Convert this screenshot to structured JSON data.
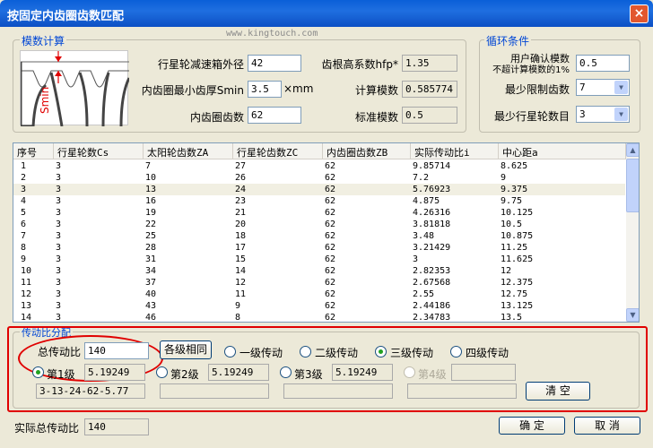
{
  "window": {
    "title": "按固定内齿圈齿数匹配",
    "close_icon": "×",
    "watermark": "www.kingtouch.com"
  },
  "calc_group": {
    "label": "模数计算",
    "diagram_label": "Smin",
    "fields": {
      "reduction_outer_diameter": {
        "label": "行星轮减速箱外径",
        "value": "42"
      },
      "min_tooth_thickness": {
        "label": "内齿圈最小齿厚Smin",
        "value": "3.5",
        "unit": "×mm"
      },
      "ring_teeth": {
        "label": "内齿圈齿数",
        "value": "62"
      },
      "root_height_coef": {
        "label": "齿根高系数hfp*",
        "value": "1.35"
      },
      "calc_module": {
        "label": "计算模数",
        "value": "0.585774"
      },
      "std_module": {
        "label": "标准模数",
        "value": "0.5"
      }
    }
  },
  "loop_group": {
    "label": "循环条件",
    "user_module": {
      "label_line1": "用户确认模数",
      "label_line2": "不超计算模数的1%",
      "value": "0.5"
    },
    "min_limit_teeth": {
      "label": "最少限制齿数",
      "value": "7"
    },
    "min_planet_count": {
      "label": "最少行星轮数目",
      "value": "3"
    }
  },
  "table": {
    "columns": [
      "序号",
      "行星轮数Cs",
      "太阳轮齿数ZA",
      "行星轮齿数ZC",
      "内齿圈齿数ZB",
      "实际传动比i",
      "中心距a"
    ],
    "rows": [
      [
        "1",
        "3",
        "7",
        "27",
        "62",
        "9.85714",
        "8.625"
      ],
      [
        "2",
        "3",
        "10",
        "26",
        "62",
        "7.2",
        "9"
      ],
      [
        "3",
        "3",
        "13",
        "24",
        "62",
        "5.76923",
        "9.375"
      ],
      [
        "4",
        "3",
        "16",
        "23",
        "62",
        "4.875",
        "9.75"
      ],
      [
        "5",
        "3",
        "19",
        "21",
        "62",
        "4.26316",
        "10.125"
      ],
      [
        "6",
        "3",
        "22",
        "20",
        "62",
        "3.81818",
        "10.5"
      ],
      [
        "7",
        "3",
        "25",
        "18",
        "62",
        "3.48",
        "10.875"
      ],
      [
        "8",
        "3",
        "28",
        "17",
        "62",
        "3.21429",
        "11.25"
      ],
      [
        "9",
        "3",
        "31",
        "15",
        "62",
        "3",
        "11.625"
      ],
      [
        "10",
        "3",
        "34",
        "14",
        "62",
        "2.82353",
        "12"
      ],
      [
        "11",
        "3",
        "37",
        "12",
        "62",
        "2.67568",
        "12.375"
      ],
      [
        "12",
        "3",
        "40",
        "11",
        "62",
        "2.55",
        "12.75"
      ],
      [
        "13",
        "3",
        "43",
        "9",
        "62",
        "2.44186",
        "13.125"
      ],
      [
        "14",
        "3",
        "46",
        "8",
        "62",
        "2.34783",
        "13.5"
      ]
    ],
    "selected_row": 2
  },
  "distribution_group": {
    "label": "传动比分配",
    "total_ratio": {
      "label": "总传动比",
      "value": "140"
    },
    "same_each_stage_button": "各级相同",
    "stage_options": [
      "一级传动",
      "二级传动",
      "三级传动",
      "四级传动"
    ],
    "selected_stage_option": 2,
    "stages": [
      {
        "label": "第1级",
        "value": "5.19249",
        "result": "3-13-24-62-5.77"
      },
      {
        "label": "第2级",
        "value": "5.19249",
        "result": ""
      },
      {
        "label": "第3级",
        "value": "5.19249",
        "result": ""
      },
      {
        "label": "第4级",
        "value": "",
        "result": ""
      }
    ],
    "clear_button": "清  空"
  },
  "footer": {
    "actual_total_ratio": {
      "label": "实际总传动比",
      "value": "140"
    },
    "ok_button": "确  定",
    "cancel_button": "取  消"
  },
  "colors": {
    "title_bar": "#0a5fd8",
    "group_label": "#0046d5",
    "highlight": "#e00000"
  }
}
